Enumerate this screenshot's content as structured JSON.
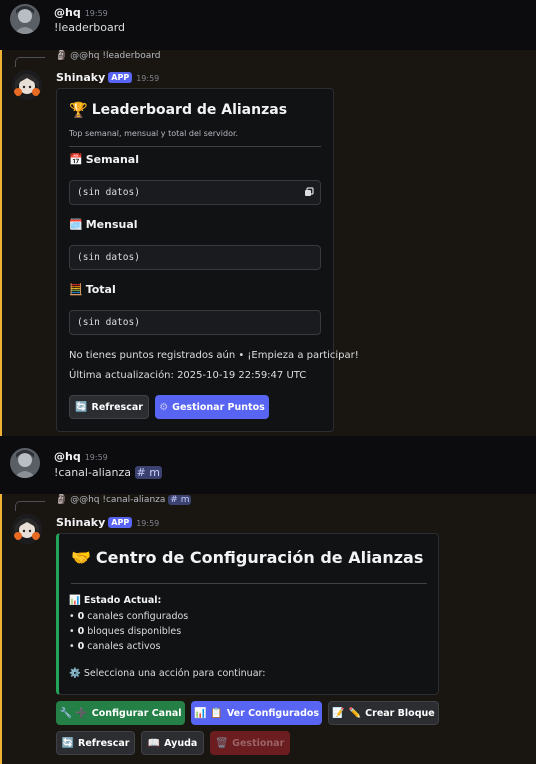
{
  "messages": {
    "m1": {
      "username": "@hq",
      "time": "19:59",
      "text": "!leaderboard"
    },
    "m2": {
      "reply_text": "@@hq !leaderboard",
      "username": "Shinaky",
      "app_badge": "APP",
      "time": "19:59",
      "embed": {
        "title": "Leaderboard de Alianzas",
        "subtitle": "Top semanal, mensual y total del servidor.",
        "fields": [
          {
            "name": "Semanal",
            "value": "(sin datos)"
          },
          {
            "name": "Mensual",
            "value": "(sin datos)"
          },
          {
            "name": "Total",
            "value": "(sin datos)"
          }
        ],
        "footer_line1": "No tienes puntos registrados aún • ¡Empieza a participar!",
        "footer_line2": "Última actualización: 2025-10-19 22:59:47 UTC"
      },
      "buttons": {
        "refresh": "Refrescar",
        "manage_points": "Gestionar Puntos"
      }
    },
    "m3": {
      "username": "@hq",
      "time": "19:59",
      "text": "!canal-alianza",
      "mention": "m"
    },
    "m4": {
      "reply_text": "@@hq !canal-alianza",
      "reply_mention": "m",
      "username": "Shinaky",
      "app_badge": "APP",
      "time": "19:59",
      "embed": {
        "title": "Centro de Configuración de Alianzas",
        "status_heading": "Estado Actual:",
        "stats": [
          {
            "count": "0",
            "label": "canales configurados"
          },
          {
            "count": "0",
            "label": "bloques disponibles"
          },
          {
            "count": "0",
            "label": "canales activos"
          }
        ],
        "prompt": "Selecciona una acción para continuar:",
        "accent_color": "#23a559"
      },
      "buttons": {
        "configure_channel": "Configurar Canal",
        "view_configured": "Ver Configurados",
        "create_block": "Crear Bloque",
        "refresh": "Refrescar",
        "help": "Ayuda",
        "manage": "Gestionar"
      }
    }
  }
}
